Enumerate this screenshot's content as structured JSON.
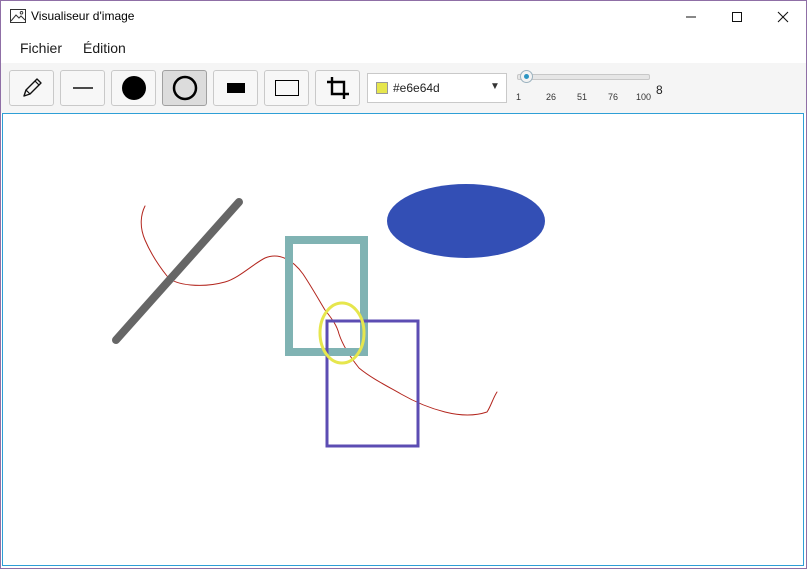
{
  "window": {
    "title": "Visualiseur d'image",
    "frame_color": "#8f6fa6"
  },
  "menu": {
    "items": [
      "Fichier",
      "Édition"
    ]
  },
  "toolbar": {
    "tools": [
      {
        "name": "pencil-tool",
        "icon": "pencil-icon",
        "selected": false
      },
      {
        "name": "line-tool",
        "icon": "line-icon",
        "selected": false
      },
      {
        "name": "filled-ellipse-tool",
        "icon": "filled-circle-icon",
        "selected": false
      },
      {
        "name": "ellipse-outline-tool",
        "icon": "circle-outline-icon",
        "selected": true
      },
      {
        "name": "filled-rectangle-tool",
        "icon": "filled-rectangle-icon",
        "selected": false
      },
      {
        "name": "rectangle-outline-tool",
        "icon": "rectangle-outline-icon",
        "selected": false
      },
      {
        "name": "crop-tool",
        "icon": "crop-icon",
        "selected": false
      }
    ],
    "color": {
      "value": "#e6e64d",
      "swatch": "#e6e64d"
    },
    "thickness": {
      "min": 1,
      "max": 100,
      "value": 8,
      "value_label": "8",
      "ticks": [
        "1",
        "26",
        "51",
        "76",
        "100"
      ]
    }
  },
  "canvas": {
    "border_color": "#2e9fd6",
    "shapes": [
      {
        "type": "freehand",
        "color": "#b3261e"
      },
      {
        "type": "line",
        "color": "#666666"
      },
      {
        "type": "filled-ellipse",
        "color": "#334fb5"
      },
      {
        "type": "rectangle-outline",
        "color": "#80b3b3"
      },
      {
        "type": "rectangle-outline",
        "color": "#5c4db3"
      },
      {
        "type": "ellipse-outline",
        "color": "#e6e64d"
      }
    ]
  }
}
